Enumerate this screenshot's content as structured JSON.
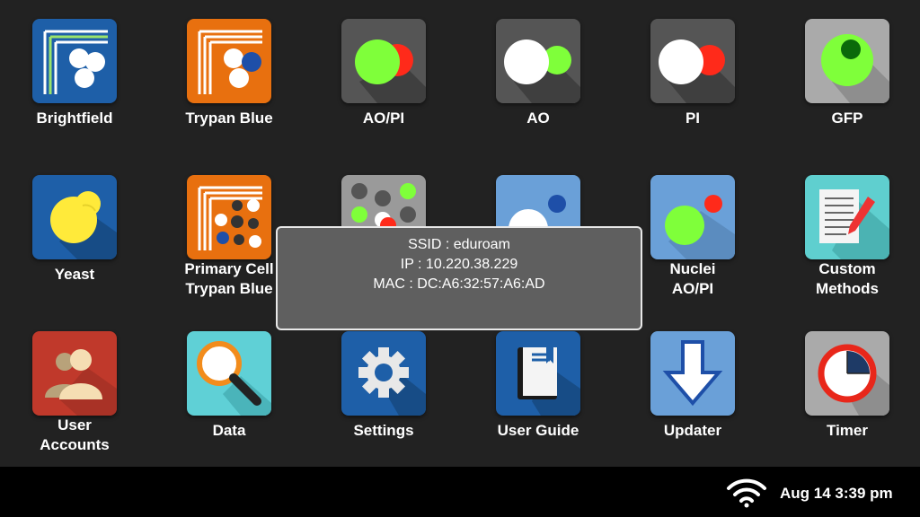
{
  "apps": [
    {
      "id": "brightfield",
      "label": "Brightfield",
      "icon": "brightfield-icon",
      "color": "#1e5fa8"
    },
    {
      "id": "trypan-blue",
      "label": "Trypan Blue",
      "icon": "trypan-blue-icon",
      "color": "#e8700f"
    },
    {
      "id": "ao-pi",
      "label": "AO/PI",
      "icon": "ao-pi-icon",
      "color": "#555555"
    },
    {
      "id": "ao",
      "label": "AO",
      "icon": "ao-icon",
      "color": "#555555"
    },
    {
      "id": "pi",
      "label": "PI",
      "icon": "pi-icon",
      "color": "#555555"
    },
    {
      "id": "gfp",
      "label": "GFP",
      "icon": "gfp-icon",
      "color": "#aaaaaa"
    },
    {
      "id": "yeast",
      "label": "Yeast",
      "icon": "yeast-icon",
      "color": "#1e5fa8"
    },
    {
      "id": "primary-cell-trypan-blue",
      "label": "Primary Cell\nTrypan Blue",
      "icon": "primary-cell-icon",
      "color": "#e8700f"
    },
    {
      "id": "hidden-1",
      "label": "",
      "icon": "dots-grid-icon",
      "color": "#9a9a9a"
    },
    {
      "id": "hidden-2",
      "label": "",
      "icon": "cells-icon",
      "color": "#6aa0d8"
    },
    {
      "id": "nuclei-ao-pi",
      "label": "Nuclei\nAO/PI",
      "icon": "nuclei-icon",
      "color": "#6aa0d8"
    },
    {
      "id": "custom-methods",
      "label": "Custom\nMethods",
      "icon": "document-pen-icon",
      "color": "#5fcfcf"
    },
    {
      "id": "user-accounts",
      "label": "User\nAccounts",
      "icon": "users-icon",
      "color": "#c0392b"
    },
    {
      "id": "data",
      "label": "Data",
      "icon": "magnifier-icon",
      "color": "#5fd0d6"
    },
    {
      "id": "settings",
      "label": "Settings",
      "icon": "gear-icon",
      "color": "#1e5fa8"
    },
    {
      "id": "user-guide",
      "label": "User Guide",
      "icon": "book-icon",
      "color": "#1e5fa8"
    },
    {
      "id": "updater",
      "label": "Updater",
      "icon": "download-arrow-icon",
      "color": "#6aa0d8"
    },
    {
      "id": "timer",
      "label": "Timer",
      "icon": "timer-icon",
      "color": "#aaaaaa"
    }
  ],
  "popup": {
    "ssid": "SSID : eduroam",
    "ip": "IP : 10.220.38.229",
    "mac": "MAC : DC:A6:32:57:A6:AD"
  },
  "status_bar": {
    "time": "Aug 14 3:39 pm",
    "wifi_icon": "wifi-icon"
  }
}
